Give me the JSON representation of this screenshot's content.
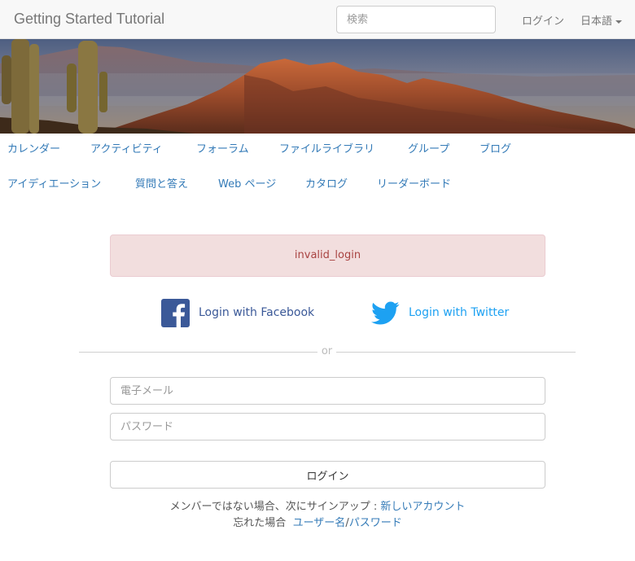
{
  "navbar": {
    "brand": "Getting Started Tutorial",
    "search_placeholder": "検索",
    "login_label": "ログイン",
    "language_label": "日本語"
  },
  "banner": {
    "image": "desert-mountain-banner"
  },
  "menu": {
    "row1": [
      {
        "label": "カレンダー"
      },
      {
        "label": "アクティビティ"
      },
      {
        "label": "フォーラム"
      },
      {
        "label": "ファイルライブラリ"
      },
      {
        "label": "グループ"
      },
      {
        "label": "ブログ"
      }
    ],
    "row2": [
      {
        "label": "アイディエーション"
      },
      {
        "label": "質問と答え"
      },
      {
        "label": "Web ページ"
      },
      {
        "label": "カタログ"
      },
      {
        "label": "リーダーボード"
      }
    ]
  },
  "alert": {
    "message": "invalid_login"
  },
  "social": {
    "facebook_label": "Login with Facebook",
    "twitter_label": "Login with Twitter"
  },
  "divider": {
    "text": "or"
  },
  "form": {
    "email_placeholder": "電子メール",
    "password_placeholder": "パスワード",
    "login_button": "ログイン"
  },
  "footer": {
    "signup_prefix": "メンバーではない場合、次にサインアップ : ",
    "signup_link": "新しいアカウント",
    "forgot_prefix": "忘れた場合",
    "username_link": "ユーザー名",
    "slash": "/",
    "password_link": "パスワード"
  },
  "colors": {
    "link": "#337ab7",
    "alert_bg": "#f2dede",
    "alert_text": "#a94442",
    "facebook": "#3b5998",
    "twitter": "#1da1f2"
  }
}
